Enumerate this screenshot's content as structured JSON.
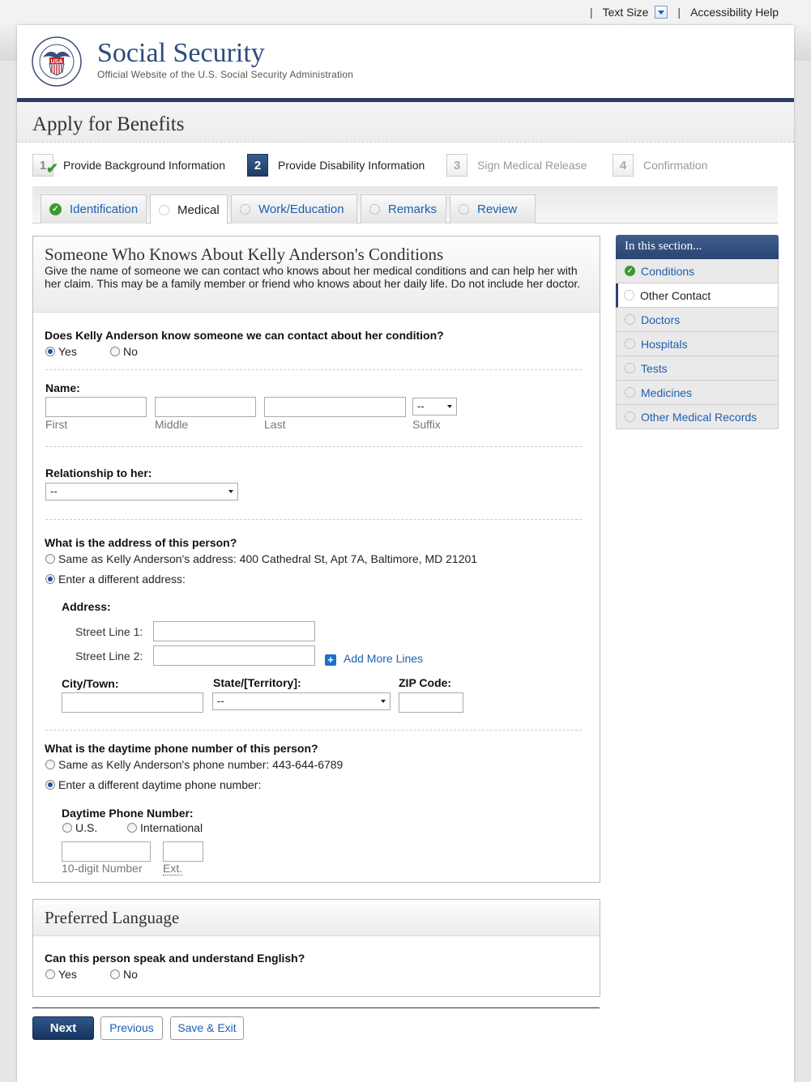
{
  "utility": {
    "text_size": "Text Size",
    "accessibility": "Accessibility Help"
  },
  "brand": {
    "title": "Social Security",
    "subtitle": "Official Website of the U.S. Social Security Administration",
    "seal_text": "SOCIAL SECURITY ADMINISTRATION",
    "seal_center": "USA"
  },
  "page_title": "Apply for Benefits",
  "steps": [
    {
      "num": "1",
      "label": "Provide Background Information",
      "state": "done"
    },
    {
      "num": "2",
      "label": "Provide Disability Information",
      "state": "active"
    },
    {
      "num": "3",
      "label": "Sign Medical Release",
      "state": "todo"
    },
    {
      "num": "4",
      "label": "Confirmation",
      "state": "todo"
    }
  ],
  "tabs": [
    {
      "label": "Identification",
      "state": "done"
    },
    {
      "label": "Medical",
      "state": "active"
    },
    {
      "label": "Work/Education",
      "state": "todo"
    },
    {
      "label": "Remarks",
      "state": "todo"
    },
    {
      "label": "Review",
      "state": "todo"
    }
  ],
  "contact": {
    "title": "Someone Who Knows About Kelly Anderson's Conditions",
    "desc": "Give the name of someone we can contact who knows about her medical conditions and can help her with her claim. This may be a family member or friend who knows about her daily life. Do not include her doctor.",
    "q_know": "Does Kelly Anderson know someone we can contact about her condition?",
    "yes": "Yes",
    "no": "No",
    "name_label": "Name:",
    "first": "First",
    "middle": "Middle",
    "last": "Last",
    "suffix": "Suffix",
    "suffix_value": "--",
    "rel_label": "Relationship to her:",
    "rel_value": "--",
    "addr_q": "What is the address of this person?",
    "addr_same": "Same as Kelly Anderson's address: 400 Cathedral St, Apt 7A, Baltimore, MD 21201",
    "addr_diff": "Enter a different address:",
    "address_label": "Address:",
    "street1": "Street Line 1:",
    "street2": "Street Line 2:",
    "add_more": "Add More Lines",
    "city": "City/Town:",
    "state": "State/[Territory]:",
    "state_value": "--",
    "zip": "ZIP Code:",
    "phone_q": "What is the daytime phone number of this person?",
    "phone_same": "Same as Kelly Anderson's phone number: 443-644-6789",
    "phone_diff": "Enter a different daytime phone number:",
    "phone_label": "Daytime Phone Number:",
    "us": "U.S.",
    "intl": "International",
    "ten_digit": "10-digit Number",
    "ext": "Ext."
  },
  "language": {
    "title": "Preferred Language",
    "q": "Can this person speak and understand English?",
    "yes": "Yes",
    "no": "No"
  },
  "sidebar": {
    "head": "In this section...",
    "items": [
      {
        "label": "Conditions",
        "state": "done"
      },
      {
        "label": "Other Contact",
        "state": "current"
      },
      {
        "label": "Doctors",
        "state": "todo"
      },
      {
        "label": "Hospitals",
        "state": "todo"
      },
      {
        "label": "Tests",
        "state": "todo"
      },
      {
        "label": "Medicines",
        "state": "todo"
      },
      {
        "label": "Other Medical Records",
        "state": "todo"
      }
    ]
  },
  "buttons": {
    "next": "Next",
    "previous": "Previous",
    "save_exit": "Save & Exit"
  }
}
